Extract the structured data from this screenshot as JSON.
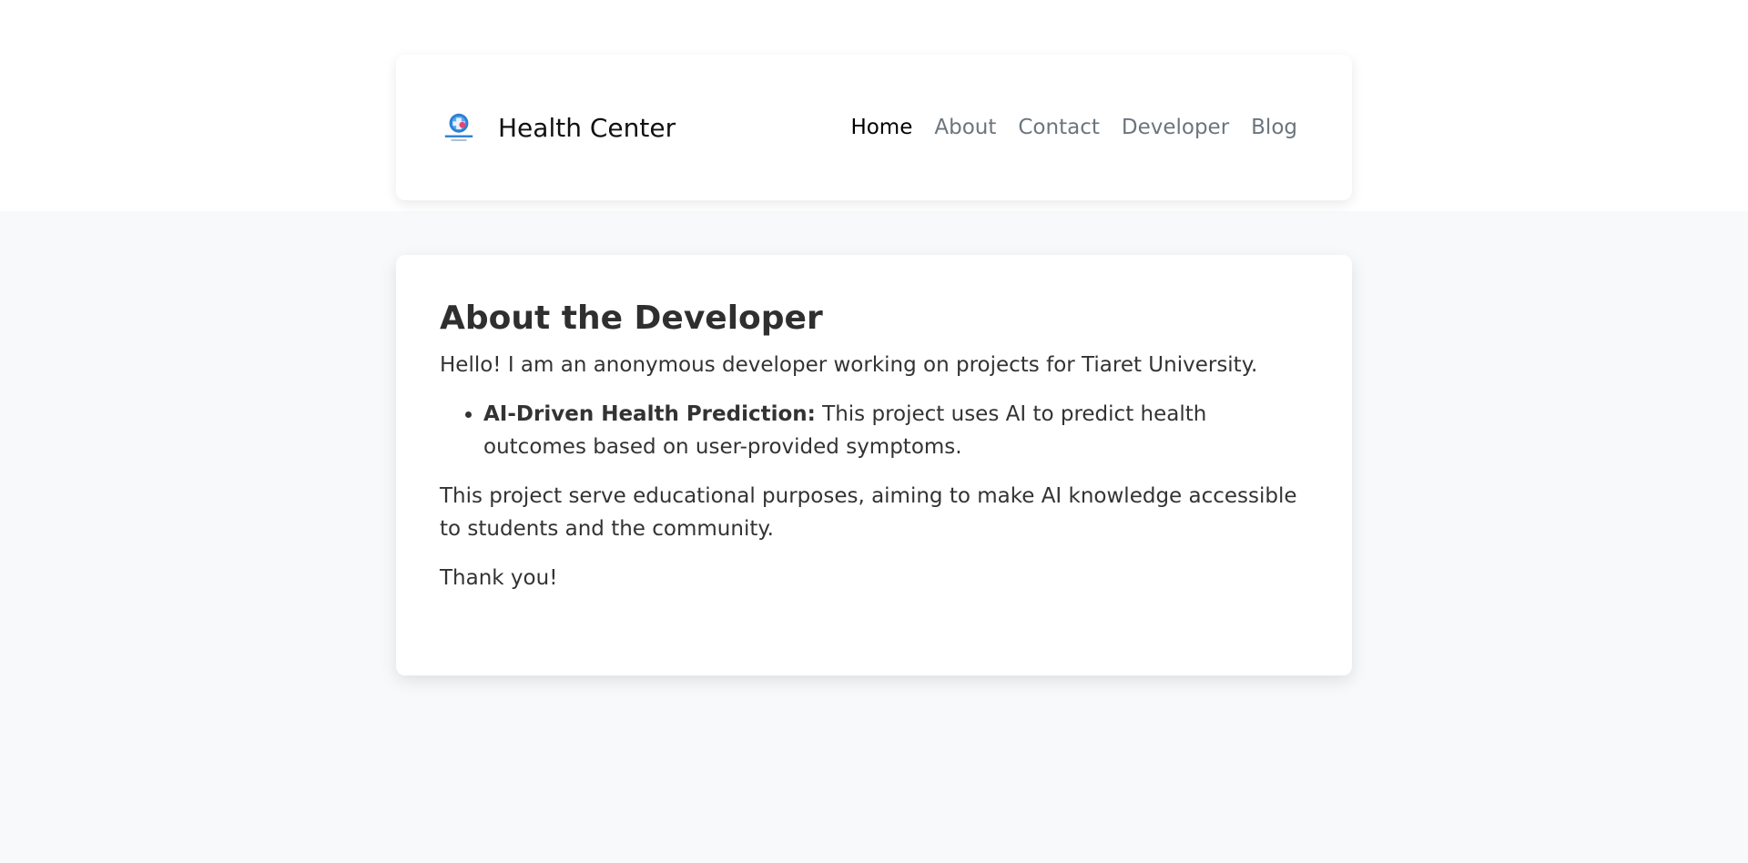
{
  "header": {
    "brand_name": "Health Center",
    "logo_icon": "health-center-logo",
    "nav": [
      {
        "label": "Home",
        "active": true
      },
      {
        "label": "About",
        "active": false
      },
      {
        "label": "Contact",
        "active": false
      },
      {
        "label": "Developer",
        "active": false
      },
      {
        "label": "Blog",
        "active": false
      }
    ]
  },
  "main": {
    "title": "About the Developer",
    "intro": "Hello! I am an anonymous developer working on projects for Tiaret University.",
    "projects": [
      {
        "name": "AI-Driven Health Prediction:",
        "description": " This project uses AI to predict health outcomes based on user-provided symptoms."
      }
    ],
    "purpose": "This project serve educational purposes, aiming to make AI knowledge accessible to students and the community.",
    "closing": "Thank you!"
  },
  "colors": {
    "page_background": "#f8f9fa",
    "card_background": "#ffffff",
    "nav_active": "#000000",
    "nav_inactive": "#6c757d",
    "text": "#333333"
  }
}
